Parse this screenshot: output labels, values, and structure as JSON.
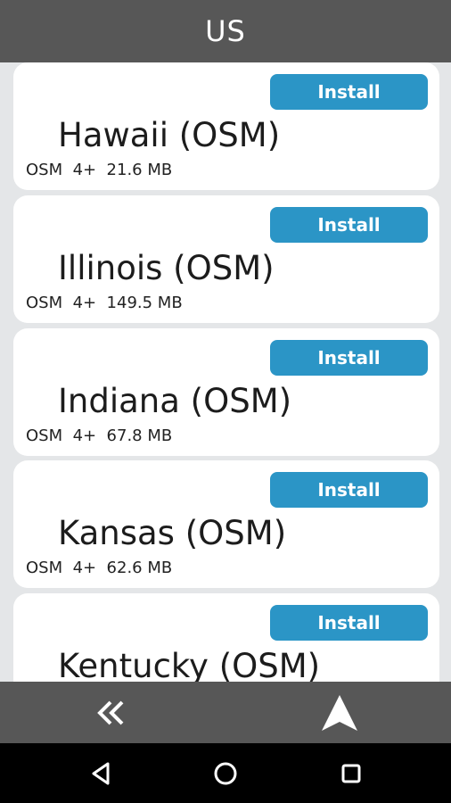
{
  "header": {
    "title": "US"
  },
  "regions": [
    {
      "name": "Hawaii (OSM)",
      "meta": "OSM  4+  21.6 MB",
      "button": "Install"
    },
    {
      "name": "Illinois (OSM)",
      "meta": "OSM  4+  149.5 MB",
      "button": "Install"
    },
    {
      "name": "Indiana (OSM)",
      "meta": "OSM  4+  67.8 MB",
      "button": "Install"
    },
    {
      "name": "Kansas (OSM)",
      "meta": "OSM  4+  62.6 MB",
      "button": "Install"
    },
    {
      "name": "Kentucky (OSM)",
      "meta": "",
      "button": "Install"
    }
  ],
  "bottom_bar": {
    "left_icon": "double-chevron-left-icon",
    "right_icon": "navigation-arrow-icon"
  },
  "system_nav": {
    "icons": [
      "back-triangle-icon",
      "home-circle-icon",
      "recents-square-icon"
    ]
  },
  "colors": {
    "header_bg": "#575757",
    "button_bg": "#2b95c6",
    "list_bg": "#e4e6e8",
    "card_bg": "#ffffff"
  }
}
